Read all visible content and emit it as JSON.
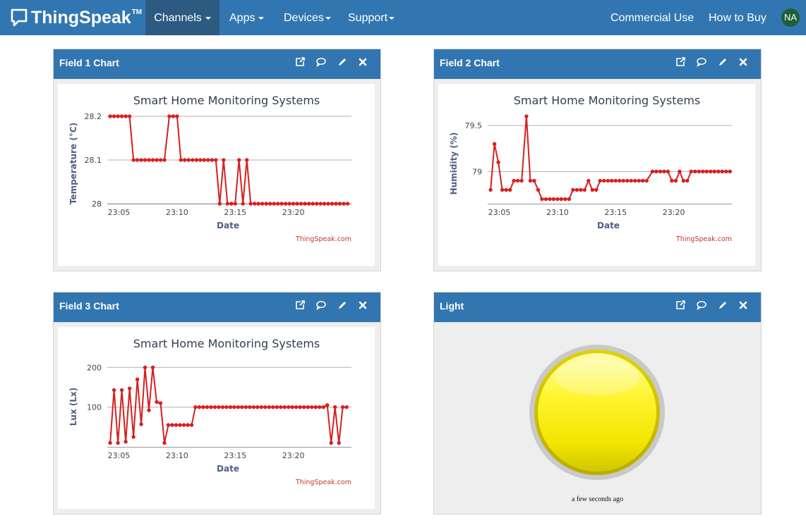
{
  "navbar": {
    "brand": "ThingSpeak",
    "trademark": "TM",
    "items": [
      {
        "label": "Channels",
        "dropdown": true,
        "active": true
      },
      {
        "label": "Apps",
        "dropdown": true
      },
      {
        "label": "Devices",
        "dropdown": true
      },
      {
        "label": "Support",
        "dropdown": true
      }
    ],
    "right_items": [
      {
        "label": "Commercial Use"
      },
      {
        "label": "How to Buy"
      }
    ],
    "avatar_initials": "NA",
    "colors": {
      "bar": "#3276b1",
      "active": "#2c5a80",
      "avatar": "#1f5e38"
    }
  },
  "widget_icons": [
    "external-link-icon",
    "comment-icon",
    "pencil-icon",
    "close-icon"
  ],
  "widgets": [
    {
      "title": "Field 1 Chart"
    },
    {
      "title": "Field 2 Chart"
    },
    {
      "title": "Field 3 Chart"
    },
    {
      "title": "Light"
    }
  ],
  "chart_data": [
    {
      "type": "line",
      "title": "Smart Home Monitoring Systems",
      "xlabel": "Date",
      "ylabel": "Temperature (°C)",
      "credit": "ThingSpeak.com",
      "color": "#d62020",
      "xlim": [
        "23:04",
        "23:25"
      ],
      "ylim": [
        28,
        28.2
      ],
      "yticks": [
        {
          "value": 28,
          "label": "28"
        },
        {
          "value": 28.1,
          "label": "28.1"
        },
        {
          "value": 28.2,
          "label": "28.2"
        }
      ],
      "xticks": [
        "23:05",
        "23:10",
        "23:15",
        "23:20"
      ],
      "series": [
        {
          "values": [
            [
              "23:04:15",
              28.2
            ],
            [
              "23:04:35",
              28.2
            ],
            [
              "23:04:55",
              28.2
            ],
            [
              "23:05:15",
              28.2
            ],
            [
              "23:05:35",
              28.2
            ],
            [
              "23:05:55",
              28.2
            ],
            [
              "23:06:15",
              28.1
            ],
            [
              "23:06:35",
              28.1
            ],
            [
              "23:06:55",
              28.1
            ],
            [
              "23:07:15",
              28.1
            ],
            [
              "23:07:35",
              28.1
            ],
            [
              "23:07:55",
              28.1
            ],
            [
              "23:08:15",
              28.1
            ],
            [
              "23:08:35",
              28.1
            ],
            [
              "23:08:55",
              28.1
            ],
            [
              "23:09:20",
              28.2
            ],
            [
              "23:09:40",
              28.2
            ],
            [
              "23:10:00",
              28.2
            ],
            [
              "23:10:20",
              28.1
            ],
            [
              "23:10:40",
              28.1
            ],
            [
              "23:11:00",
              28.1
            ],
            [
              "23:11:20",
              28.1
            ],
            [
              "23:11:40",
              28.1
            ],
            [
              "23:12:00",
              28.1
            ],
            [
              "23:12:20",
              28.1
            ],
            [
              "23:12:40",
              28.1
            ],
            [
              "23:13:00",
              28.1
            ],
            [
              "23:13:20",
              28.1
            ],
            [
              "23:13:40",
              28.0
            ],
            [
              "23:14:00",
              28.1
            ],
            [
              "23:14:20",
              28.0
            ],
            [
              "23:14:40",
              28.0
            ],
            [
              "23:15:00",
              28.0
            ],
            [
              "23:15:20",
              28.1
            ],
            [
              "23:15:40",
              28.0
            ],
            [
              "23:16:00",
              28.1
            ],
            [
              "23:16:20",
              28.0
            ],
            [
              "23:16:40",
              28.0
            ],
            [
              "23:17:00",
              28.0
            ],
            [
              "23:17:20",
              28.0
            ],
            [
              "23:17:40",
              28.0
            ],
            [
              "23:18:00",
              28.0
            ],
            [
              "23:18:20",
              28.0
            ],
            [
              "23:18:40",
              28.0
            ],
            [
              "23:19:00",
              28.0
            ],
            [
              "23:19:20",
              28.0
            ],
            [
              "23:19:40",
              28.0
            ],
            [
              "23:20:00",
              28.0
            ],
            [
              "23:20:20",
              28.0
            ],
            [
              "23:20:40",
              28.0
            ],
            [
              "23:21:00",
              28.0
            ],
            [
              "23:21:20",
              28.0
            ],
            [
              "23:21:40",
              28.0
            ],
            [
              "23:22:00",
              28.0
            ],
            [
              "23:22:20",
              28.0
            ],
            [
              "23:22:40",
              28.0
            ],
            [
              "23:23:00",
              28.0
            ],
            [
              "23:23:20",
              28.0
            ],
            [
              "23:23:40",
              28.0
            ],
            [
              "23:24:00",
              28.0
            ],
            [
              "23:24:20",
              28.0
            ],
            [
              "23:24:40",
              28.0
            ]
          ]
        }
      ]
    },
    {
      "type": "line",
      "title": "Smart Home Monitoring Systems",
      "xlabel": "Date",
      "ylabel": "Humidity (%)",
      "credit": "ThingSpeak.com",
      "color": "#d62020",
      "xlim": [
        "23:04",
        "23:25"
      ],
      "ylim": [
        78.65,
        79.6
      ],
      "yticks": [
        {
          "value": 79,
          "label": "79"
        },
        {
          "value": 79.5,
          "label": "79.5"
        }
      ],
      "xticks": [
        "23:05",
        "23:10",
        "23:15",
        "23:20"
      ],
      "series": [
        {
          "values": [
            [
              "23:04:15",
              78.8
            ],
            [
              "23:04:35",
              79.3
            ],
            [
              "23:04:55",
              79.1
            ],
            [
              "23:05:15",
              78.8
            ],
            [
              "23:05:35",
              78.8
            ],
            [
              "23:05:55",
              78.8
            ],
            [
              "23:06:15",
              78.9
            ],
            [
              "23:06:35",
              78.9
            ],
            [
              "23:06:55",
              78.9
            ],
            [
              "23:07:20",
              79.6
            ],
            [
              "23:07:40",
              78.9
            ],
            [
              "23:08:00",
              78.9
            ],
            [
              "23:08:20",
              78.8
            ],
            [
              "23:08:40",
              78.7
            ],
            [
              "23:09:00",
              78.7
            ],
            [
              "23:09:20",
              78.7
            ],
            [
              "23:09:40",
              78.7
            ],
            [
              "23:10:00",
              78.7
            ],
            [
              "23:10:20",
              78.7
            ],
            [
              "23:10:40",
              78.7
            ],
            [
              "23:11:00",
              78.7
            ],
            [
              "23:11:20",
              78.8
            ],
            [
              "23:11:40",
              78.8
            ],
            [
              "23:12:00",
              78.8
            ],
            [
              "23:12:20",
              78.8
            ],
            [
              "23:12:40",
              78.9
            ],
            [
              "23:13:00",
              78.8
            ],
            [
              "23:13:20",
              78.8
            ],
            [
              "23:13:40",
              78.9
            ],
            [
              "23:14:00",
              78.9
            ],
            [
              "23:14:20",
              78.9
            ],
            [
              "23:14:40",
              78.9
            ],
            [
              "23:15:00",
              78.9
            ],
            [
              "23:15:20",
              78.9
            ],
            [
              "23:15:40",
              78.9
            ],
            [
              "23:16:00",
              78.9
            ],
            [
              "23:16:20",
              78.9
            ],
            [
              "23:16:40",
              78.9
            ],
            [
              "23:17:00",
              78.9
            ],
            [
              "23:17:20",
              78.9
            ],
            [
              "23:17:40",
              78.9
            ],
            [
              "23:18:10",
              79.0
            ],
            [
              "23:18:30",
              79.0
            ],
            [
              "23:18:50",
              79.0
            ],
            [
              "23:19:10",
              79.0
            ],
            [
              "23:19:30",
              79.0
            ],
            [
              "23:19:50",
              78.9
            ],
            [
              "23:20:10",
              78.9
            ],
            [
              "23:20:30",
              79.0
            ],
            [
              "23:20:50",
              78.9
            ],
            [
              "23:21:10",
              78.9
            ],
            [
              "23:21:30",
              79.0
            ],
            [
              "23:21:50",
              79.0
            ],
            [
              "23:22:10",
              79.0
            ],
            [
              "23:22:30",
              79.0
            ],
            [
              "23:22:50",
              79.0
            ],
            [
              "23:23:10",
              79.0
            ],
            [
              "23:23:30",
              79.0
            ],
            [
              "23:23:50",
              79.0
            ],
            [
              "23:24:10",
              79.0
            ],
            [
              "23:24:30",
              79.0
            ],
            [
              "23:24:50",
              79.0
            ]
          ]
        }
      ]
    },
    {
      "type": "line",
      "title": "Smart Home Monitoring Systems",
      "xlabel": "Date",
      "ylabel": "Lux (Lx)",
      "credit": "ThingSpeak.com",
      "color": "#d62020",
      "xlim": [
        "23:04",
        "23:25"
      ],
      "ylim": [
        0,
        220
      ],
      "yticks": [
        {
          "value": 100,
          "label": "100"
        },
        {
          "value": 200,
          "label": "200"
        }
      ],
      "xticks": [
        "23:05",
        "23:10",
        "23:15",
        "23:20"
      ],
      "series": [
        {
          "values": [
            [
              "23:04:15",
              10
            ],
            [
              "23:04:35",
              143
            ],
            [
              "23:04:55",
              10
            ],
            [
              "23:05:15",
              143
            ],
            [
              "23:05:35",
              13
            ],
            [
              "23:05:55",
              147
            ],
            [
              "23:06:15",
              25
            ],
            [
              "23:06:35",
              170
            ],
            [
              "23:06:55",
              57
            ],
            [
              "23:07:15",
              200
            ],
            [
              "23:07:35",
              92
            ],
            [
              "23:07:55",
              200
            ],
            [
              "23:08:15",
              113
            ],
            [
              "23:08:35",
              110
            ],
            [
              "23:08:55",
              10
            ],
            [
              "23:09:15",
              55
            ],
            [
              "23:09:35",
              55
            ],
            [
              "23:09:55",
              55
            ],
            [
              "23:10:15",
              55
            ],
            [
              "23:10:35",
              55
            ],
            [
              "23:10:55",
              55
            ],
            [
              "23:11:15",
              55
            ],
            [
              "23:11:35",
              100
            ],
            [
              "23:11:55",
              100
            ],
            [
              "23:12:15",
              100
            ],
            [
              "23:12:35",
              100
            ],
            [
              "23:12:55",
              100
            ],
            [
              "23:13:15",
              100
            ],
            [
              "23:13:35",
              100
            ],
            [
              "23:13:55",
              100
            ],
            [
              "23:14:15",
              100
            ],
            [
              "23:14:35",
              100
            ],
            [
              "23:14:55",
              100
            ],
            [
              "23:15:15",
              100
            ],
            [
              "23:15:35",
              100
            ],
            [
              "23:15:55",
              100
            ],
            [
              "23:16:15",
              100
            ],
            [
              "23:16:35",
              100
            ],
            [
              "23:16:55",
              100
            ],
            [
              "23:17:15",
              100
            ],
            [
              "23:17:35",
              100
            ],
            [
              "23:17:55",
              100
            ],
            [
              "23:18:15",
              100
            ],
            [
              "23:18:35",
              100
            ],
            [
              "23:18:55",
              100
            ],
            [
              "23:19:15",
              100
            ],
            [
              "23:19:35",
              100
            ],
            [
              "23:19:55",
              100
            ],
            [
              "23:20:15",
              100
            ],
            [
              "23:20:35",
              100
            ],
            [
              "23:20:55",
              100
            ],
            [
              "23:21:15",
              100
            ],
            [
              "23:21:35",
              100
            ],
            [
              "23:21:55",
              100
            ],
            [
              "23:22:15",
              100
            ],
            [
              "23:22:35",
              100
            ],
            [
              "23:22:55",
              105
            ],
            [
              "23:23:15",
              10
            ],
            [
              "23:23:35",
              100
            ],
            [
              "23:23:55",
              10
            ],
            [
              "23:24:15",
              100
            ],
            [
              "23:24:35",
              100
            ]
          ]
        }
      ]
    }
  ],
  "lamp": {
    "caption": "a few seconds ago",
    "state": "on",
    "color": "#fff200"
  }
}
